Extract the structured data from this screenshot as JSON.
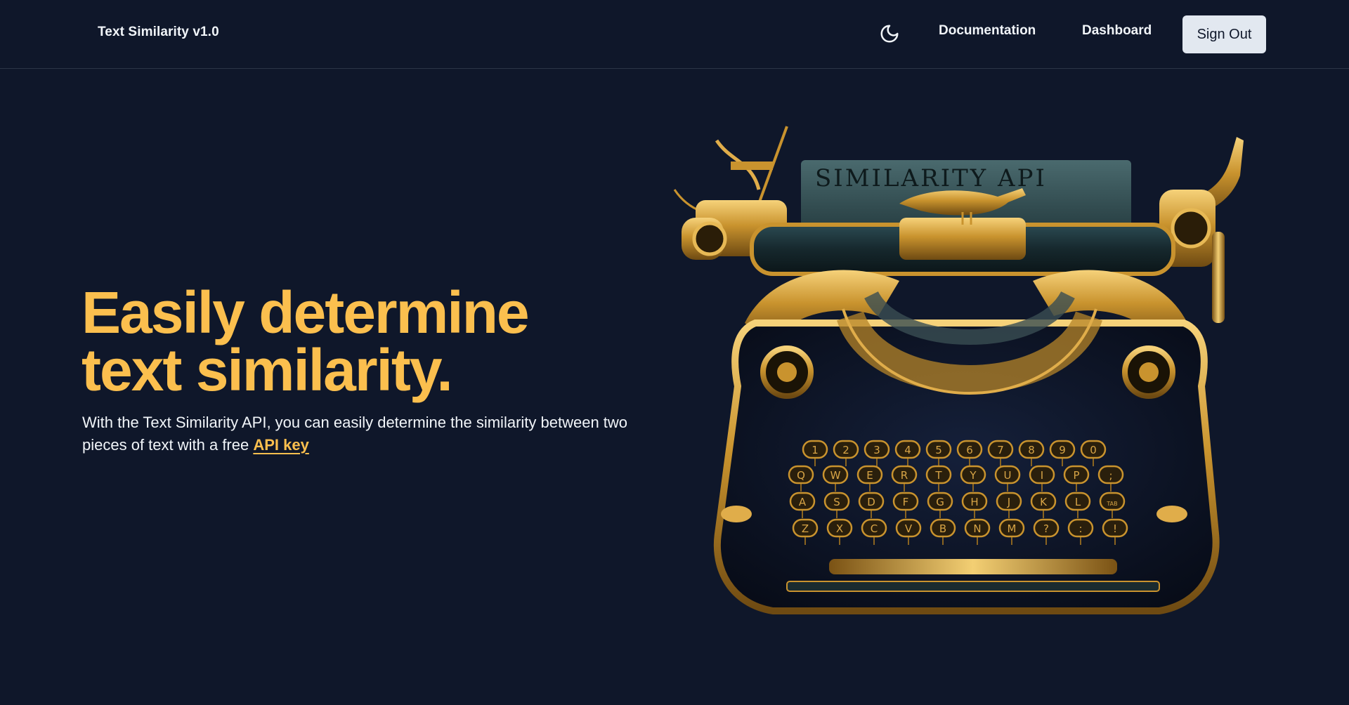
{
  "nav": {
    "brand": "Text Similarity v1.0",
    "theme_icon": "moon-icon",
    "links": [
      {
        "label": "Documentation"
      },
      {
        "label": "Dashboard"
      }
    ],
    "signout_label": "Sign Out"
  },
  "hero": {
    "title_line1": "Easily determine",
    "title_line2": "text similarity.",
    "desc_prefix": "With the Text Similarity API, you can easily determine the similarity between two pieces of text with a free ",
    "api_key_link": "API key"
  },
  "illustration": {
    "paper_text": "SIMILARITY API",
    "key_rows": [
      [
        "1",
        "2",
        "3",
        "4",
        "5",
        "6",
        "7",
        "8",
        "9",
        "0"
      ],
      [
        "Q",
        "W",
        "E",
        "R",
        "T",
        "Y",
        "U",
        "I",
        "P",
        ";"
      ],
      [
        "A",
        "S",
        "D",
        "F",
        "G",
        "H",
        "J",
        "K",
        "L",
        "TAB"
      ],
      [
        "Z",
        "X",
        "C",
        "V",
        "B",
        "N",
        "M",
        "?",
        ":",
        "!"
      ]
    ]
  },
  "colors": {
    "background": "#0f172a",
    "accent": "#fbbf4e",
    "text": "#f1f5f9",
    "button_bg": "#e2e8f0",
    "gold": "#c9932e"
  }
}
